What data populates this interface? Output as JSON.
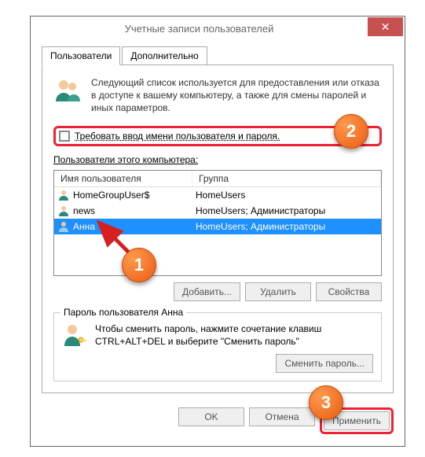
{
  "window": {
    "title": "Учетные записи пользователей"
  },
  "tabs": {
    "t0": "Пользователи",
    "t1": "Дополнительно"
  },
  "intro": "Следующий список используется для предоставления или отказа в доступе к вашему компьютеру, а также для смены паролей и иных параметров.",
  "checkbox": {
    "label": "Требовать ввод имени пользователя и пароля."
  },
  "section": {
    "users_label": "Пользователи этого компьютера:"
  },
  "list": {
    "headers": {
      "name": "Имя пользователя",
      "group": "Группа"
    },
    "rows": [
      {
        "name": "HomeGroupUser$",
        "group": "HomeUsers"
      },
      {
        "name": "news",
        "group": "HomeUsers; Администраторы"
      },
      {
        "name": "Анна",
        "group": "HomeUsers; Администраторы",
        "selected": true
      }
    ]
  },
  "buttons": {
    "add": "Добавить...",
    "delete": "Удалить",
    "props": "Свойства",
    "change_pw": "Сменить пароль...",
    "ok": "OK",
    "cancel": "Отмена",
    "apply": "Применить"
  },
  "password_box": {
    "legend": "Пароль пользователя Анна",
    "text": "Чтобы сменить пароль, нажмите сочетание клавиш CTRL+ALT+DEL и выберите \"Сменить пароль\""
  },
  "callouts": {
    "c1": "1",
    "c2": "2",
    "c3": "3"
  }
}
